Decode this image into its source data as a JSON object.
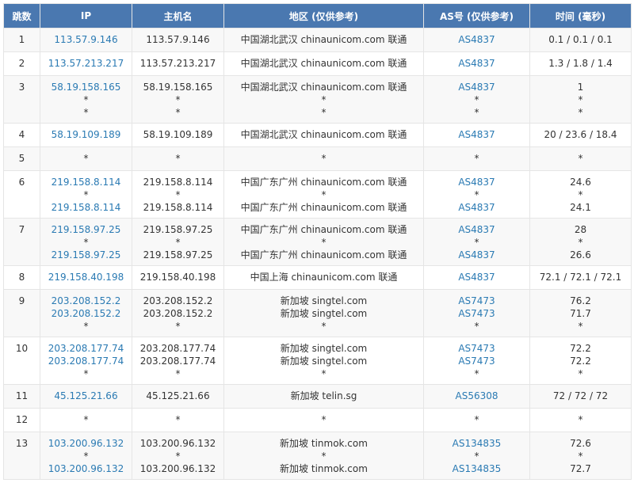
{
  "headers": {
    "hop": "跳数",
    "ip": "IP",
    "host": "主机名",
    "region": "地区 (仅供参考)",
    "asn": "AS号 (仅供参考)",
    "time": "时间 (毫秒)"
  },
  "rows": [
    {
      "hop": "1",
      "ip": [
        "113.57.9.146"
      ],
      "host": [
        "113.57.9.146"
      ],
      "region": [
        "中国湖北武汉 chinaunicom.com 联通"
      ],
      "as": [
        "AS4837"
      ],
      "time": [
        "0.1 / 0.1 / 0.1"
      ]
    },
    {
      "hop": "2",
      "ip": [
        "113.57.213.217"
      ],
      "host": [
        "113.57.213.217"
      ],
      "region": [
        "中国湖北武汉 chinaunicom.com 联通"
      ],
      "as": [
        "AS4837"
      ],
      "time": [
        "1.3 / 1.8 / 1.4"
      ]
    },
    {
      "hop": "3",
      "ip": [
        "58.19.158.165",
        "*",
        "*"
      ],
      "host": [
        "58.19.158.165",
        "*",
        "*"
      ],
      "region": [
        "中国湖北武汉 chinaunicom.com 联通",
        "*",
        "*"
      ],
      "as": [
        "AS4837",
        "*",
        "*"
      ],
      "time": [
        "1",
        "*",
        "*"
      ]
    },
    {
      "hop": "4",
      "ip": [
        "58.19.109.189"
      ],
      "host": [
        "58.19.109.189"
      ],
      "region": [
        "中国湖北武汉 chinaunicom.com 联通"
      ],
      "as": [
        "AS4837"
      ],
      "time": [
        "20 / 23.6 / 18.4"
      ]
    },
    {
      "hop": "5",
      "ip": [
        "*"
      ],
      "host": [
        "*"
      ],
      "region": [
        "*"
      ],
      "as": [
        "*"
      ],
      "time": [
        "*"
      ]
    },
    {
      "hop": "6",
      "ip": [
        "219.158.8.114",
        "*",
        "219.158.8.114"
      ],
      "host": [
        "219.158.8.114",
        "*",
        "219.158.8.114"
      ],
      "region": [
        "中国广东广州 chinaunicom.com 联通",
        "*",
        "中国广东广州 chinaunicom.com 联通"
      ],
      "as": [
        "AS4837",
        "*",
        "AS4837"
      ],
      "time": [
        "24.6",
        "*",
        "24.1"
      ]
    },
    {
      "hop": "7",
      "ip": [
        "219.158.97.25",
        "*",
        "219.158.97.25"
      ],
      "host": [
        "219.158.97.25",
        "*",
        "219.158.97.25"
      ],
      "region": [
        "中国广东广州 chinaunicom.com 联通",
        "*",
        "中国广东广州 chinaunicom.com 联通"
      ],
      "as": [
        "AS4837",
        "*",
        "AS4837"
      ],
      "time": [
        "28",
        "*",
        "26.6"
      ]
    },
    {
      "hop": "8",
      "ip": [
        "219.158.40.198"
      ],
      "host": [
        "219.158.40.198"
      ],
      "region": [
        "中国上海 chinaunicom.com 联通"
      ],
      "as": [
        "AS4837"
      ],
      "time": [
        "72.1 / 72.1 / 72.1"
      ]
    },
    {
      "hop": "9",
      "ip": [
        "203.208.152.2",
        "203.208.152.2",
        "*"
      ],
      "host": [
        "203.208.152.2",
        "203.208.152.2",
        "*"
      ],
      "region": [
        "新加坡 singtel.com",
        "新加坡 singtel.com",
        "*"
      ],
      "as": [
        "AS7473",
        "AS7473",
        "*"
      ],
      "time": [
        "76.2",
        "71.7",
        "*"
      ]
    },
    {
      "hop": "10",
      "ip": [
        "203.208.177.74",
        "203.208.177.74",
        "*"
      ],
      "host": [
        "203.208.177.74",
        "203.208.177.74",
        "*"
      ],
      "region": [
        "新加坡 singtel.com",
        "新加坡 singtel.com",
        "*"
      ],
      "as": [
        "AS7473",
        "AS7473",
        "*"
      ],
      "time": [
        "72.2",
        "72.2",
        "*"
      ]
    },
    {
      "hop": "11",
      "ip": [
        "45.125.21.66"
      ],
      "host": [
        "45.125.21.66"
      ],
      "region": [
        "新加坡 telin.sg"
      ],
      "as": [
        "AS56308"
      ],
      "time": [
        "72 / 72 / 72"
      ]
    },
    {
      "hop": "12",
      "ip": [
        "*"
      ],
      "host": [
        "*"
      ],
      "region": [
        "*"
      ],
      "as": [
        "*"
      ],
      "time": [
        "*"
      ]
    },
    {
      "hop": "13",
      "ip": [
        "103.200.96.132",
        "*",
        "103.200.96.132"
      ],
      "host": [
        "103.200.96.132",
        "*",
        "103.200.96.132"
      ],
      "region": [
        "新加坡 tinmok.com",
        "*",
        "新加坡 tinmok.com"
      ],
      "as": [
        "AS134835",
        "*",
        "AS134835"
      ],
      "time": [
        "72.6",
        "*",
        "72.7"
      ]
    }
  ],
  "colors": {
    "header_bg": "#4a78b0",
    "link": "#2a7ab3",
    "stripe": "#f8f8f8",
    "border": "#e5e5e5"
  }
}
